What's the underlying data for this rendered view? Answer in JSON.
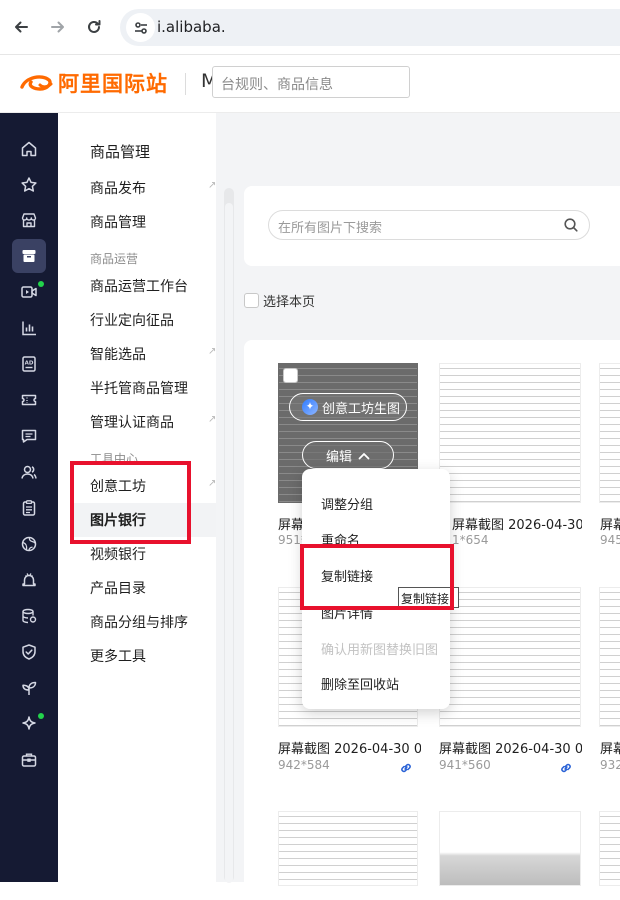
{
  "browser": {
    "url": "i.alibaba.",
    "back_icon": "arrow-left-icon",
    "forward_icon": "arrow-right-icon",
    "reload_icon": "reload-icon",
    "site_info_icon": "tune-icon"
  },
  "header": {
    "logo_text": "阿里国际站",
    "logo_m": "M",
    "search_placeholder": "台规则、商品信息",
    "brand_color": "#ff6a00"
  },
  "rail": {
    "icons": [
      "home-icon",
      "star-icon",
      "store-icon",
      "box-icon",
      "video-icon",
      "bar-chart-icon",
      "ad-icon",
      "ticket-icon",
      "message-icon",
      "people-icon",
      "clipboard-icon",
      "globe-icon",
      "bell-icon",
      "database-icon",
      "shield-icon",
      "sprout-icon",
      "sparkle-icon",
      "briefcase-icon"
    ],
    "active_index": 3,
    "bg_color": "#151a33"
  },
  "menu": {
    "title": "商品管理",
    "items": {
      "publish": "商品发布",
      "manage": "商品管理",
      "group_ops": "商品运营",
      "workbench": "商品运营工作台",
      "industry": "行业定向征品",
      "smart": "智能选品",
      "semi": "半托管商品管理",
      "certified": "管理认证商品",
      "group_tools": "工具中心",
      "studio": "创意工坊",
      "image_bank": "图片银行",
      "video_bank": "视频银行",
      "catalog": "产品目录",
      "grouping": "商品分组与排序",
      "more": "更多工具"
    }
  },
  "main": {
    "search_placeholder": "在所有图片下搜索",
    "select_page": "选择本页",
    "overlay": {
      "studio_label": "创意工坊生图",
      "edit_label": "编辑"
    },
    "dropdown": {
      "regroup": "调整分组",
      "rename": "重命名",
      "copy_link": "复制链接",
      "details": "图片详情",
      "replace": "确认用新图替换旧图",
      "delete": "删除至回收站"
    },
    "tooltip": "复制链接",
    "items": [
      {
        "name": "屏幕",
        "size": "951*"
      },
      {
        "name": "屏幕截图 2026-04-30 1...",
        "size": "1*654"
      },
      {
        "name": "屏幕",
        "size": "945"
      },
      {
        "name": "屏幕截图 2026-04-30 0...",
        "size": "942*584"
      },
      {
        "name": "屏幕截图 2026-04-30 0...",
        "size": "941*560"
      },
      {
        "name": "屏幕",
        "size": "932"
      }
    ]
  },
  "annotation_color": "#e8112d"
}
